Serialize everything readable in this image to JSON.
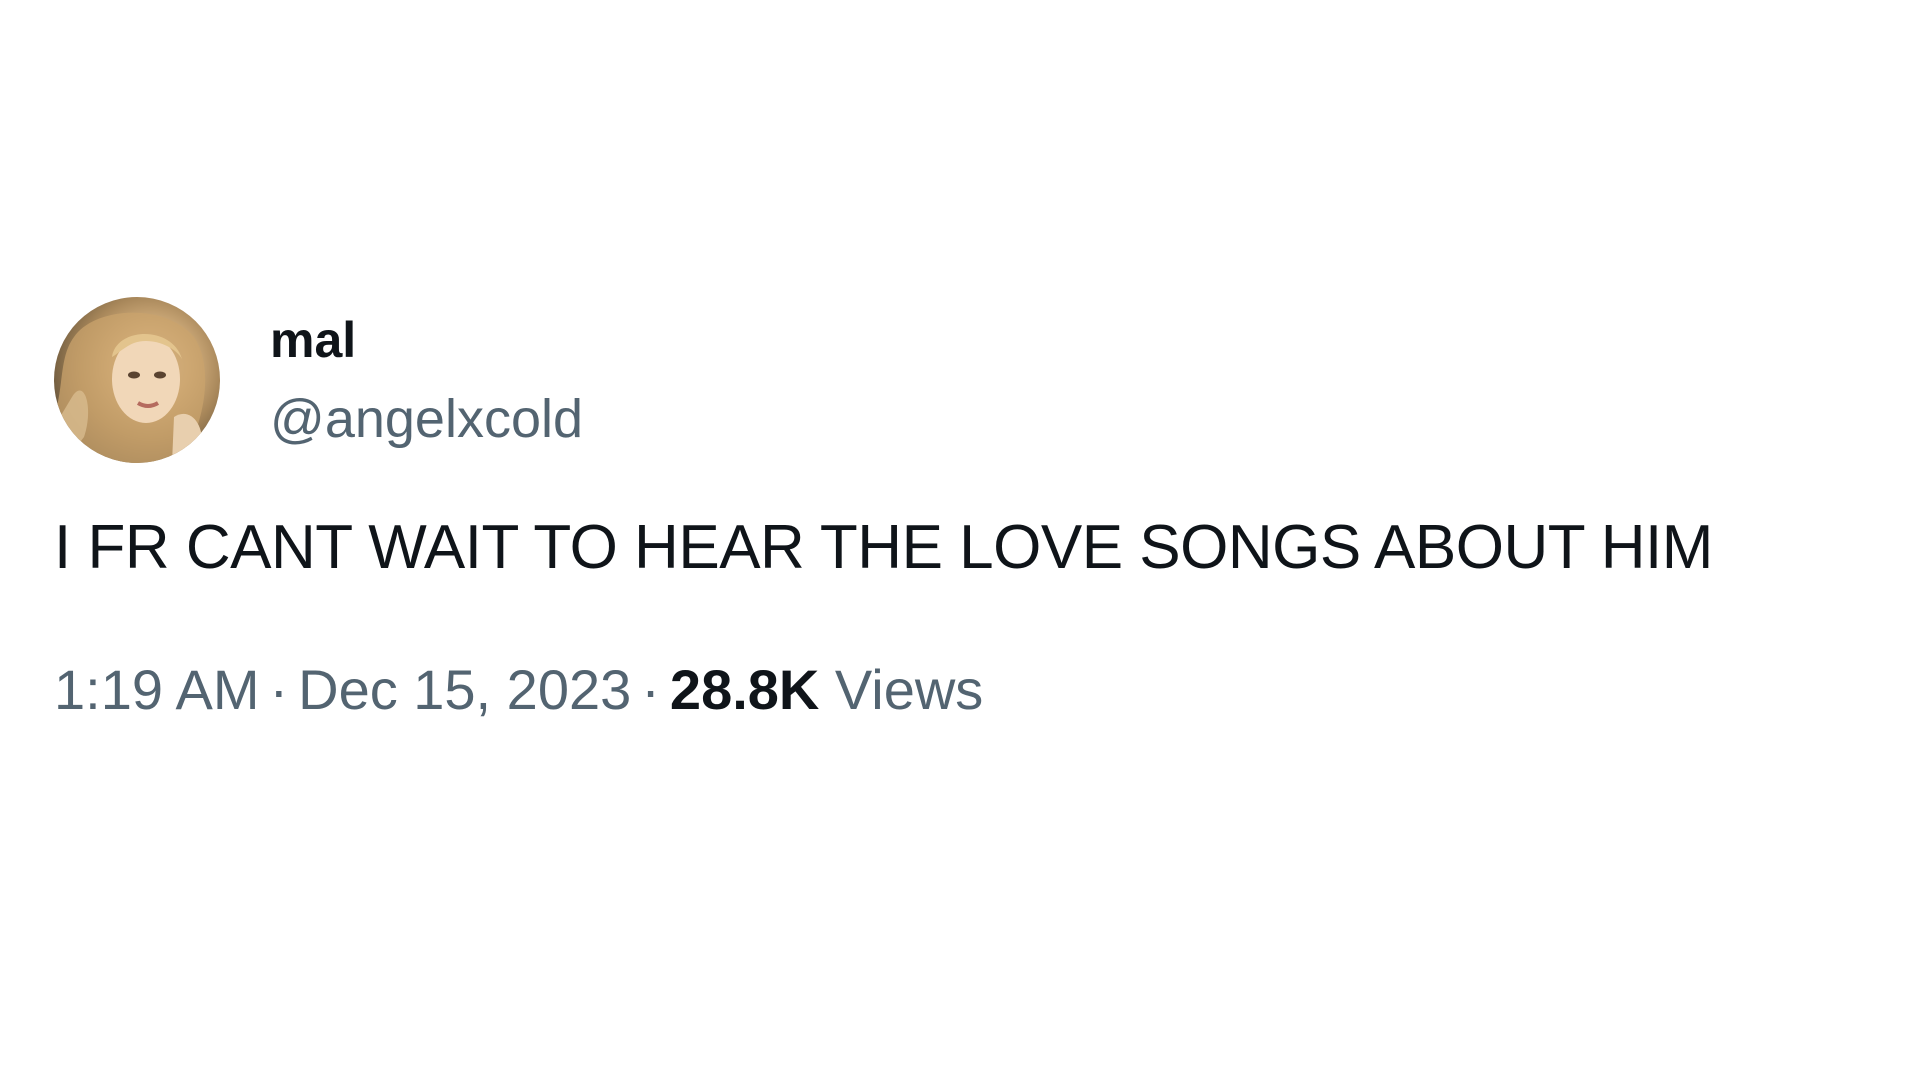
{
  "tweet": {
    "display_name": "mal",
    "handle": "@angelxcold",
    "text": "I FR CANT WAIT TO HEAR THE LOVE SONGS ABOUT HIM",
    "time": "1:19 AM",
    "separator": "·",
    "date": "Dec 15, 2023",
    "views_count": "28.8K",
    "views_label": "Views",
    "avatar_icon": "profile-photo"
  },
  "colors": {
    "primary_text": "#0f1419",
    "secondary_text": "#536471",
    "background": "#ffffff"
  }
}
